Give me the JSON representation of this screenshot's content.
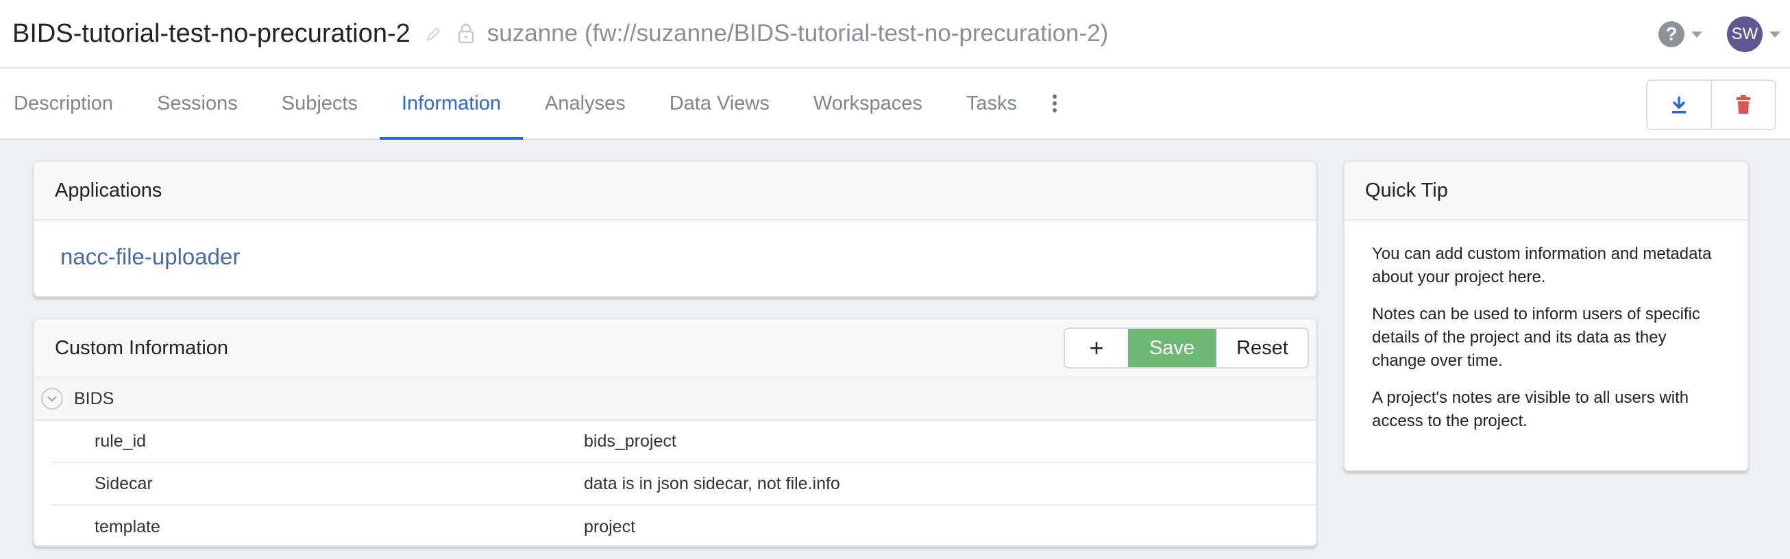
{
  "header": {
    "project_title": "BIDS-tutorial-test-no-precuration-2",
    "project_path": "suzanne (fw://suzanne/BIDS-tutorial-test-no-precuration-2)",
    "help_symbol": "?",
    "user_initials": "SW"
  },
  "tabs": [
    {
      "label": "Description"
    },
    {
      "label": "Sessions"
    },
    {
      "label": "Subjects"
    },
    {
      "label": "Information"
    },
    {
      "label": "Analyses"
    },
    {
      "label": "Data Views"
    },
    {
      "label": "Workspaces"
    },
    {
      "label": "Tasks"
    }
  ],
  "active_tab": "Information",
  "applications": {
    "title": "Applications",
    "items": [
      {
        "label": "nacc-file-uploader"
      }
    ]
  },
  "custom_info": {
    "title": "Custom Information",
    "add_label": "+",
    "save_label": "Save",
    "reset_label": "Reset",
    "group": {
      "label": "BIDS",
      "rows": [
        {
          "key": "rule_id",
          "value": "bids_project"
        },
        {
          "key": "Sidecar",
          "value": "data is in json sidecar, not file.info"
        },
        {
          "key": "template",
          "value": "project"
        }
      ]
    }
  },
  "quick_tip": {
    "title": "Quick Tip",
    "paragraphs": [
      "You can add custom information and metadata about your project here.",
      "Notes can be used to inform users of specific details of the project and its data as they change over time.",
      "A project's notes are visible to all users with access to the project."
    ]
  },
  "colors": {
    "accent": "#2f66d5",
    "save_green": "#6cb874",
    "delete_red": "#d9534f",
    "avatar_bg": "#5e5791",
    "link": "#4a6aa5"
  },
  "icons": [
    "pencil-icon",
    "lock-icon",
    "help-icon",
    "download-icon",
    "trash-icon",
    "kebab-icon",
    "chevron-down-icon"
  ]
}
